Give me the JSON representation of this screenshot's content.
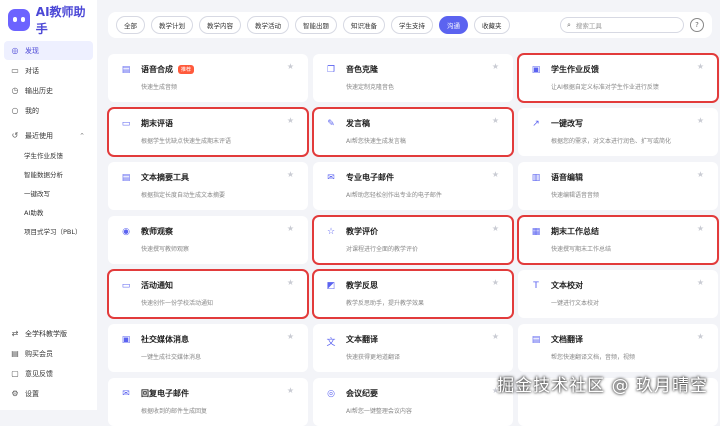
{
  "app": {
    "title": "AI教师助手"
  },
  "sidebar": {
    "items": [
      {
        "label": "发现",
        "icon": "compass-icon",
        "active": true
      },
      {
        "label": "对话",
        "icon": "chat-icon"
      },
      {
        "label": "输出历史",
        "icon": "clock-icon"
      },
      {
        "label": "我的",
        "icon": "user-icon"
      }
    ],
    "recent_label": "最近使用",
    "recent_items": [
      "学生作业反馈",
      "智能数据分析",
      "一键改写",
      "AI助教",
      "项目式学习（PBL）"
    ],
    "bottom_items": [
      {
        "label": "全学科教学版",
        "icon": "link-icon"
      },
      {
        "label": "购买会员",
        "icon": "shop-icon"
      },
      {
        "label": "意见反馈",
        "icon": "feedback-icon"
      },
      {
        "label": "设置",
        "icon": "gear-icon"
      }
    ]
  },
  "filters": {
    "chips": [
      "全部",
      "教学计划",
      "教学内容",
      "教学活动",
      "智能出题",
      "知识准备",
      "学生支持",
      "沟通",
      "收藏夹"
    ],
    "active": "沟通",
    "search_placeholder": "搜索工具"
  },
  "tools": [
    {
      "title": "语音合成",
      "desc": "快速生成音频",
      "icon": "document-icon",
      "badge": "推荐",
      "highlight": false
    },
    {
      "title": "音色克隆",
      "desc": "快速定制克隆音色",
      "icon": "copy-icon",
      "highlight": false
    },
    {
      "title": "学生作业反馈",
      "desc": "让AI根据自定义标准对学生作业进行反馈",
      "icon": "assignment-icon",
      "highlight": true
    },
    {
      "title": "期末评语",
      "desc": "根据学生优缺点快速生成期末评语",
      "icon": "comment-icon",
      "highlight": true
    },
    {
      "title": "发言稿",
      "desc": "AI帮您快速生成发言稿",
      "icon": "script-icon",
      "highlight": true
    },
    {
      "title": "一键改写",
      "desc": "根据您的需求，对文本进行润色、扩写或简化",
      "icon": "rewrite-icon",
      "highlight": false
    },
    {
      "title": "文本摘要工具",
      "desc": "根据指定长度自动生成文本摘要",
      "icon": "summary-icon",
      "highlight": false
    },
    {
      "title": "专业电子邮件",
      "desc": "AI帮助您轻松创作出专业的电子邮件",
      "icon": "mail-icon",
      "highlight": false
    },
    {
      "title": "语音编辑",
      "desc": "快速编辑语音音频",
      "icon": "audio-icon",
      "highlight": false
    },
    {
      "title": "教师观察",
      "desc": "快速撰写教师观察",
      "icon": "eye-icon",
      "highlight": false
    },
    {
      "title": "教学评价",
      "desc": "对课程进行全面的教学评价",
      "icon": "star-outline-icon",
      "highlight": true
    },
    {
      "title": "期末工作总结",
      "desc": "快速撰写期末工作总结",
      "icon": "report-icon",
      "highlight": true
    },
    {
      "title": "活动通知",
      "desc": "快速创作一份学校活动通知",
      "icon": "notice-icon",
      "highlight": true
    },
    {
      "title": "教学反思",
      "desc": "教学反思助手，提升教学效果",
      "icon": "reflection-icon",
      "highlight": true
    },
    {
      "title": "文本校对",
      "desc": "一键进行文本校对",
      "icon": "proofread-icon",
      "highlight": false
    },
    {
      "title": "社交媒体消息",
      "desc": "一键生成社交媒体消息",
      "icon": "social-icon",
      "highlight": false
    },
    {
      "title": "文本翻译",
      "desc": "快速获得更地道翻译",
      "icon": "translate-icon",
      "highlight": false
    },
    {
      "title": "文档翻译",
      "desc": "帮您快速翻译文档，音频，视频",
      "icon": "doc-translate-icon",
      "highlight": false
    },
    {
      "title": "回复电子邮件",
      "desc": "根据收到的邮件生成回复",
      "icon": "reply-mail-icon",
      "highlight": false
    },
    {
      "title": "会议纪要",
      "desc": "AI帮您一键整理会议内容",
      "icon": "meeting-icon",
      "highlight": false
    },
    {
      "title": "",
      "desc": "",
      "icon": "",
      "highlight": false
    }
  ],
  "watermark": "掘金技术社区 @ 玖月晴空"
}
